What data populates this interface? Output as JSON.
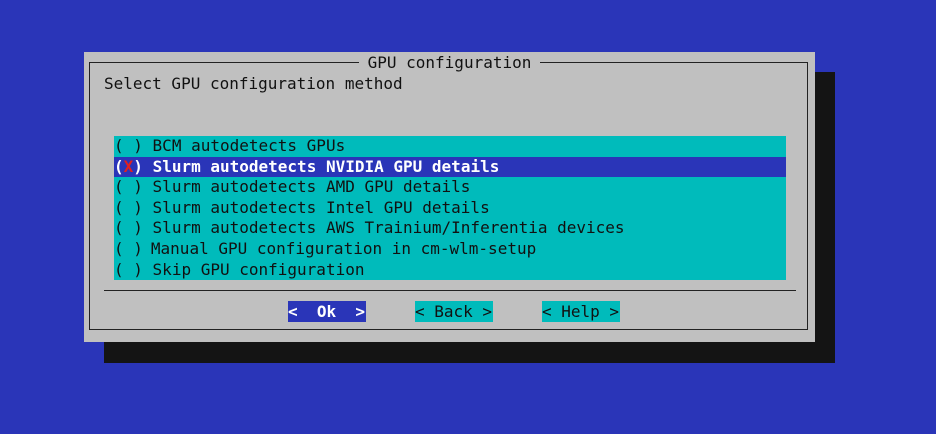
{
  "dialog": {
    "title": "GPU configuration",
    "prompt": "Select GPU configuration method"
  },
  "options": [
    {
      "radio": "( )",
      "label": "BCM autodetects GPUs",
      "selected": false
    },
    {
      "radio_open": "(",
      "radio_mark": "X",
      "radio_close": ")",
      "label": "Slurm autodetects NVIDIA GPU details",
      "selected": true
    },
    {
      "radio": "( )",
      "label": "Slurm autodetects AMD GPU details",
      "selected": false
    },
    {
      "radio": "( )",
      "label": "Slurm autodetects Intel GPU details",
      "selected": false
    },
    {
      "radio": "( )",
      "label": "Slurm autodetects AWS Trainium/Inferentia devices",
      "selected": false
    },
    {
      "radio": "( )",
      "label": "Manual GPU configuration in cm-wlm-setup",
      "selected": false
    },
    {
      "radio": "( )",
      "label": "Skip GPU configuration",
      "selected": false
    }
  ],
  "buttons": {
    "ok": "<  Ok  >",
    "back": "< Back >",
    "help": "< Help >"
  },
  "colors": {
    "background": "#2a35b8",
    "dialog": "#c0c0c0",
    "list": "#00bbbb",
    "highlight": "#2a35b8",
    "mark": "#e02020"
  }
}
